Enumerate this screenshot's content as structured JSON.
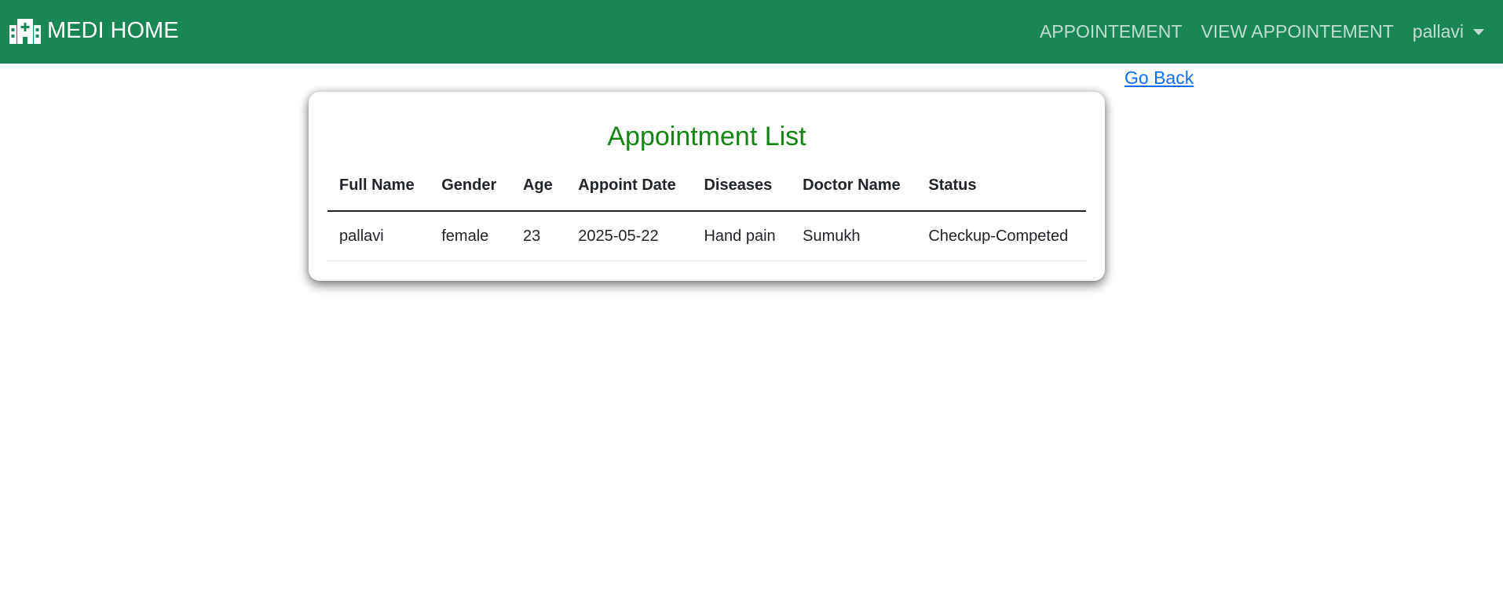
{
  "navbar": {
    "brand": "MEDI HOME",
    "brand_icon": "hospital-icon",
    "links": [
      "APPOINTEMENT",
      "VIEW APPOINTEMENT"
    ],
    "user": "pallavi",
    "bg_color": "#198754"
  },
  "go_back": "Go Back",
  "card": {
    "title": "Appointment List",
    "title_color": "#138513"
  },
  "table": {
    "headers": [
      "Full Name",
      "Gender",
      "Age",
      "Appoint Date",
      "Diseases",
      "Doctor Name",
      "Status"
    ],
    "rows": [
      [
        "pallavi",
        "female",
        "23",
        "2025-05-22",
        "Hand pain",
        "Sumukh",
        "Checkup-Competed"
      ]
    ]
  }
}
